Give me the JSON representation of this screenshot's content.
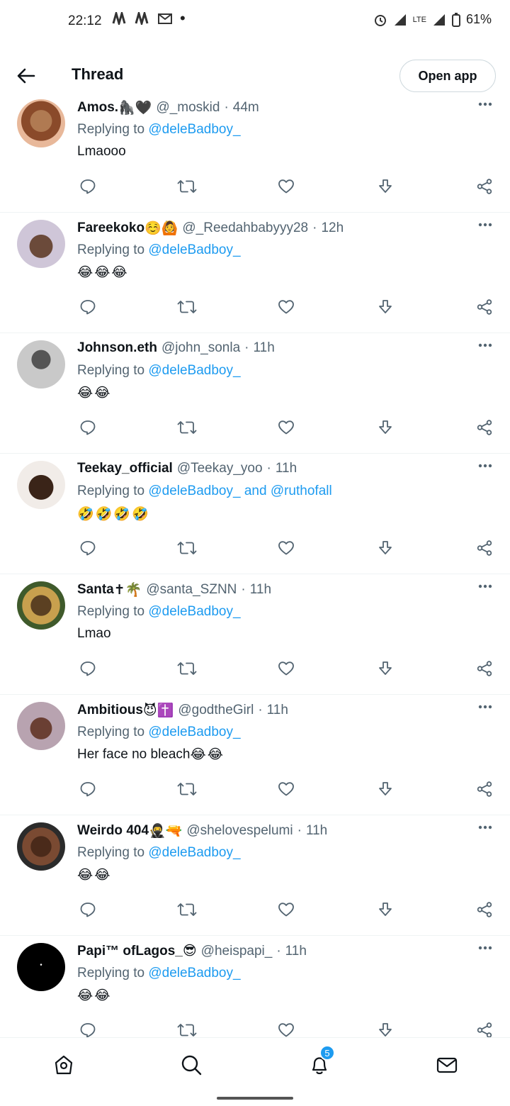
{
  "status_bar": {
    "time": "22:12",
    "battery": "61%",
    "network": "LTE"
  },
  "header": {
    "title": "Thread",
    "open_app_label": "Open app"
  },
  "tweets": [
    {
      "name": "Amos.",
      "handle": "@_moskid",
      "time": "44m",
      "replying_label": "Replying to",
      "mentions": "@deleBadboy_",
      "text": "Lmaooo",
      "emojis": []
    },
    {
      "name": "Fareekoko",
      "handle": "@_Reedahbabyyy28",
      "time": "12h",
      "replying_label": "Replying to",
      "mentions": "@deleBadboy_",
      "text": "",
      "emojis": [
        "😂",
        "😂",
        "😂"
      ]
    },
    {
      "name": "Johnson.eth",
      "handle": "@john_sonla",
      "time": "11h",
      "replying_label": "Replying to",
      "mentions": "@deleBadboy_",
      "text": "",
      "emojis": [
        "😂",
        "😂"
      ]
    },
    {
      "name": "Teekay_official",
      "handle": "@Teekay_yoo",
      "time": "11h",
      "replying_label": "Replying to",
      "mentions": "@deleBadboy_ and @ruthofall",
      "text": "",
      "emojis": [
        "🤣",
        "🤣",
        "🤣",
        "🤣"
      ]
    },
    {
      "name": "Santa",
      "handle": "@santa_SZNN",
      "time": "11h",
      "replying_label": "Replying to",
      "mentions": "@deleBadboy_",
      "text": "Lmao",
      "emojis": []
    },
    {
      "name": "Ambitious",
      "handle": "@godtheGirl",
      "time": "11h",
      "replying_label": "Replying to",
      "mentions": "@deleBadboy_",
      "text": "Her face no bleach",
      "emojis": [
        "😂",
        "😂"
      ]
    },
    {
      "name": "Weirdo 404",
      "handle": "@shelovespelumi",
      "time": "11h",
      "replying_label": "Replying to",
      "mentions": "@deleBadboy_",
      "text": "",
      "emojis": [
        "😂",
        "😂"
      ]
    },
    {
      "name": "Papi™ ofLagos_",
      "handle": "@heispapi_",
      "time": "11h",
      "replying_label": "Replying to",
      "mentions": "@deleBadboy_",
      "text": "",
      "emojis": [
        "😂",
        "😂"
      ]
    }
  ],
  "name_emojis": [
    "🦍🖤",
    "☺️🙆",
    "",
    "",
    "✝🌴",
    "😈✝️",
    "🥷🔫",
    "😎"
  ],
  "bottom_nav": {
    "notifications_badge": "5"
  },
  "colors": {
    "accent": "#1d9bf0",
    "text": "#0f1419",
    "secondary": "#536471"
  }
}
